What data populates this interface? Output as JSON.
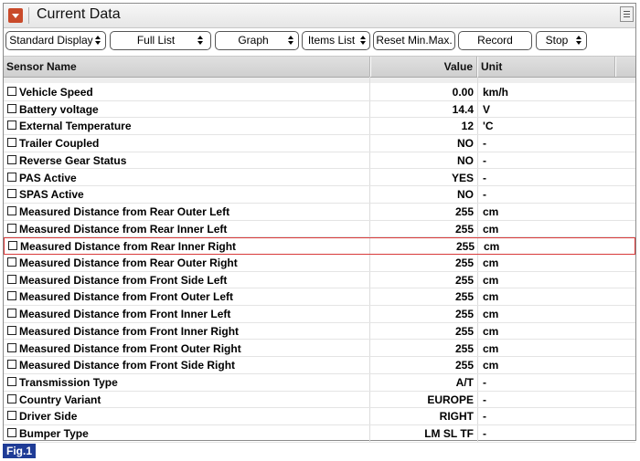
{
  "window": {
    "title": "Current Data"
  },
  "toolbar": {
    "display_mode": "Standard Display",
    "list_mode": "Full List",
    "graph": "Graph",
    "items_list": "Items List",
    "reset": "Reset Min.Max.",
    "record": "Record",
    "stop": "Stop"
  },
  "table": {
    "headers": {
      "name": "Sensor Name",
      "value": "Value",
      "unit": "Unit"
    },
    "rows": [
      {
        "name": "Vehicle Speed",
        "value": "0.00",
        "unit": "km/h"
      },
      {
        "name": "Battery voltage",
        "value": "14.4",
        "unit": "V"
      },
      {
        "name": "External Temperature",
        "value": "12",
        "unit": "'C"
      },
      {
        "name": "Trailer Coupled",
        "value": "NO",
        "unit": "-"
      },
      {
        "name": "Reverse Gear Status",
        "value": "NO",
        "unit": "-"
      },
      {
        "name": "PAS Active",
        "value": "YES",
        "unit": "-"
      },
      {
        "name": "SPAS Active",
        "value": "NO",
        "unit": "-"
      },
      {
        "name": "Measured Distance from Rear Outer Left",
        "value": "255",
        "unit": "cm"
      },
      {
        "name": "Measured Distance from Rear Inner Left",
        "value": "255",
        "unit": "cm"
      },
      {
        "name": "Measured Distance from Rear Inner Right",
        "value": "255",
        "unit": "cm",
        "selected": true
      },
      {
        "name": "Measured Distance from Rear Outer Right",
        "value": "255",
        "unit": "cm"
      },
      {
        "name": "Measured Distance from Front Side Left",
        "value": "255",
        "unit": "cm"
      },
      {
        "name": "Measured Distance from Front Outer Left",
        "value": "255",
        "unit": "cm"
      },
      {
        "name": "Measured Distance from Front Inner Left",
        "value": "255",
        "unit": "cm"
      },
      {
        "name": "Measured Distance from Front Inner Right",
        "value": "255",
        "unit": "cm"
      },
      {
        "name": "Measured Distance from Front Outer Right",
        "value": "255",
        "unit": "cm"
      },
      {
        "name": "Measured Distance from Front Side Right",
        "value": "255",
        "unit": "cm"
      },
      {
        "name": "Transmission Type",
        "value": "A/T",
        "unit": "-"
      },
      {
        "name": "Country Variant",
        "value": "EUROPE",
        "unit": "-"
      },
      {
        "name": "Driver Side",
        "value": "RIGHT",
        "unit": "-"
      },
      {
        "name": "Bumper Type",
        "value": "LM SL TF",
        "unit": "-"
      }
    ]
  },
  "figure_label": "Fig.1",
  "colors": {
    "selection": "#d93a3a",
    "figure_badge": "#1f3c96",
    "collapse_button": "#c94a2a"
  },
  "icons": {
    "collapse": "collapse-arrow-icon",
    "menu": "menu-icon",
    "spinner": "spinner-arrows-icon",
    "checkbox": "checkbox-icon"
  }
}
